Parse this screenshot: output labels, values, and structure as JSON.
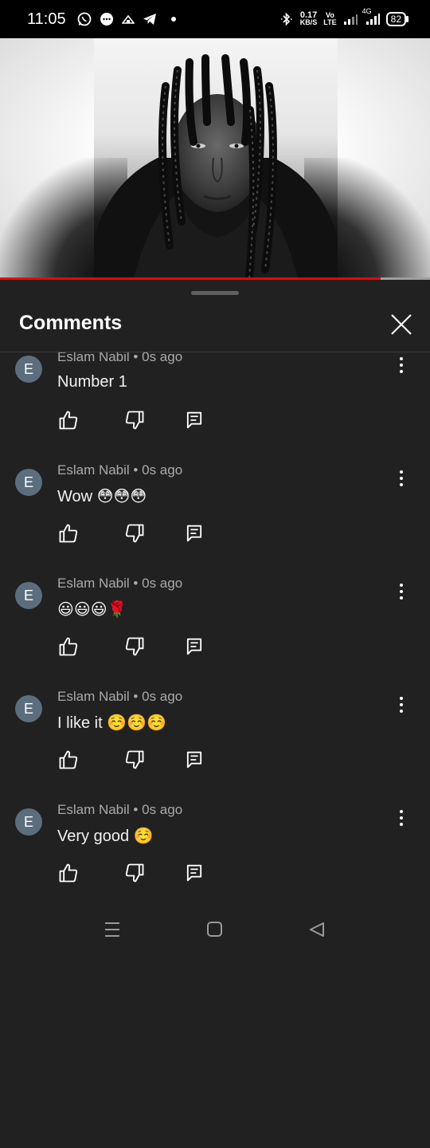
{
  "status_bar": {
    "time": "11:05",
    "net_speed_value": "0.17",
    "net_speed_unit": "KB/S",
    "volte_top": "Vo",
    "volte_bottom": "LTE",
    "network": "4G",
    "battery": "82"
  },
  "video": {
    "progress": 0.885,
    "progress_color": "#ff0000"
  },
  "comments_panel": {
    "title": "Comments",
    "items": [
      {
        "avatar": "E",
        "author": "Eslam Nabil",
        "time": "0s ago",
        "text": "Number 1"
      },
      {
        "avatar": "E",
        "author": "Eslam Nabil",
        "time": "0s ago",
        "text": "Wow 😳😳😳"
      },
      {
        "avatar": "E",
        "author": "Eslam Nabil",
        "time": "0s ago",
        "text": "😃😃😃🌹"
      },
      {
        "avatar": "E",
        "author": "Eslam Nabil",
        "time": "0s ago",
        "text": "I like it ☺️☺️☺️"
      },
      {
        "avatar": "E",
        "author": "Eslam Nabil",
        "time": "0s ago",
        "text": "Very good ☺️"
      }
    ]
  },
  "colors": {
    "sheet_bg": "#212121",
    "avatar_bg": "#5b6e7d",
    "meta_text": "#aaaaaa"
  }
}
